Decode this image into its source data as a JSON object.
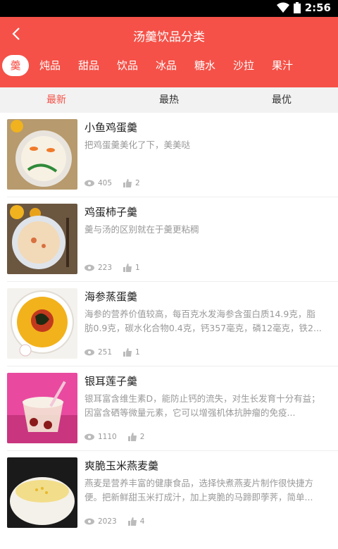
{
  "status": {
    "time": "2:56",
    "wifi_icon": "wifi-icon",
    "battery_icon": "battery-icon"
  },
  "header": {
    "title": "汤羹饮品分类",
    "back_icon": "back-arrow-icon",
    "accent": "#f55148"
  },
  "categories": [
    {
      "label": "羹",
      "active": true
    },
    {
      "label": "炖品"
    },
    {
      "label": "甜品"
    },
    {
      "label": "饮品"
    },
    {
      "label": "冰品"
    },
    {
      "label": "糖水"
    },
    {
      "label": "沙拉"
    },
    {
      "label": "果汁"
    }
  ],
  "sort_tabs": [
    {
      "label": "最新",
      "active": true
    },
    {
      "label": "最热"
    },
    {
      "label": "最优"
    }
  ],
  "items": [
    {
      "title": "小鱼鸡蛋羹",
      "desc": "把鸡蛋羹美化了下，美美哒",
      "views": "405",
      "likes": "2"
    },
    {
      "title": "鸡蛋柿子羹",
      "desc": "羹与汤的区别就在于羹更粘稠",
      "views": "223",
      "likes": "1"
    },
    {
      "title": "海参蒸蛋羹",
      "desc": "海参的营养价值较高，每百克水发海参含蛋白质14.9克，脂肪0.9克，碳水化合物0.4克，钙357毫克，磷12毫克，铁2...",
      "views": "251",
      "likes": "1"
    },
    {
      "title": "银耳莲子羹",
      "desc": "银耳富含维生素D，能防止钙的流失，对生长发育十分有益；因富含硒等微量元素，它可以增强机体抗肿瘤的免疫...",
      "views": "1110",
      "likes": "2"
    },
    {
      "title": "爽脆玉米燕麦羹",
      "desc": "燕麦是营养丰富的健康食品，选择快煮燕麦片制作很快捷方便。把新鲜甜玉米打成汁，加上爽脆的马蹄即荸荠，简单...",
      "views": "2023",
      "likes": "4"
    }
  ]
}
